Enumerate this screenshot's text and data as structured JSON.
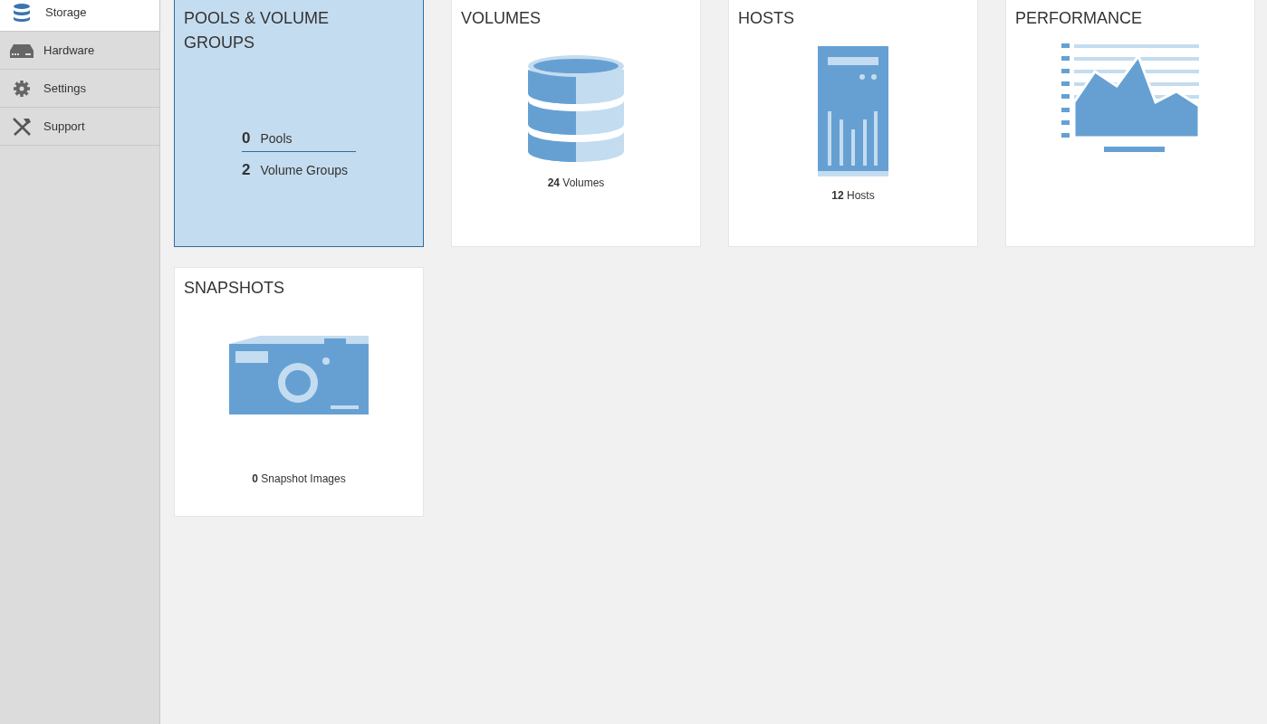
{
  "sidebar": {
    "items": [
      {
        "label": "Storage",
        "selected": true
      },
      {
        "label": "Hardware",
        "selected": false
      },
      {
        "label": "Settings",
        "selected": false
      },
      {
        "label": "Support",
        "selected": false
      }
    ]
  },
  "tiles": [
    {
      "kind": "groups",
      "title": "POOLS & VOLUME GROUPS",
      "selected": true,
      "stats": [
        {
          "count": "0",
          "label": "Pools"
        },
        {
          "count": "2",
          "label": "Volume Groups"
        }
      ]
    },
    {
      "kind": "volumes",
      "title": "VOLUMES",
      "selected": false,
      "summary": "**24** Volumes"
    },
    {
      "kind": "hosts",
      "title": "HOSTS",
      "selected": false,
      "summary": "**12** Hosts"
    },
    {
      "kind": "performance",
      "title": "PERFORMANCE",
      "selected": false
    },
    {
      "kind": "snapshots",
      "title": "SNAPSHOTS",
      "selected": false,
      "summary": "**0** Snapshot Images"
    }
  ]
}
